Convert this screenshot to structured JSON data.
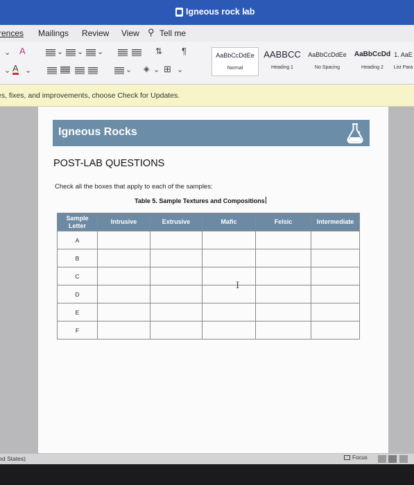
{
  "window": {
    "title": "Igneous rock lab"
  },
  "ribbon_tabs": [
    "rences",
    "Mailings",
    "Review",
    "View",
    "Tell me"
  ],
  "styles": [
    {
      "sample": "AaBbCcDdEe",
      "name": "Normal"
    },
    {
      "sample": "AABBCC",
      "name": "Heading 1"
    },
    {
      "sample": "AaBbCcDdEe",
      "name": "No Spacing"
    },
    {
      "sample": "AaBbCcDd",
      "name": "Heading 2"
    },
    {
      "sample": "1. AaE",
      "name": "List Para"
    }
  ],
  "update_message": "es, fixes, and improvements, choose Check for Updates.",
  "document": {
    "header": "Igneous Rocks",
    "heading": "POST-LAB QUESTIONS",
    "instruction": "Check all the boxes that apply to each of the samples:",
    "caption": "Table 5. Sample Textures and Compositions",
    "columns": [
      "Sample Letter",
      "Intrusive",
      "Extrusive",
      "Mafic",
      "Felsic",
      "Intermediate"
    ],
    "rows": [
      "A",
      "B",
      "C",
      "D",
      "E",
      "F"
    ]
  },
  "status": {
    "language": "ited States)",
    "focus": "Focus"
  },
  "colors": {
    "title_bar": "#2c59b6",
    "header_band": "#6b8da7",
    "table_header": "#6c8aa3"
  }
}
